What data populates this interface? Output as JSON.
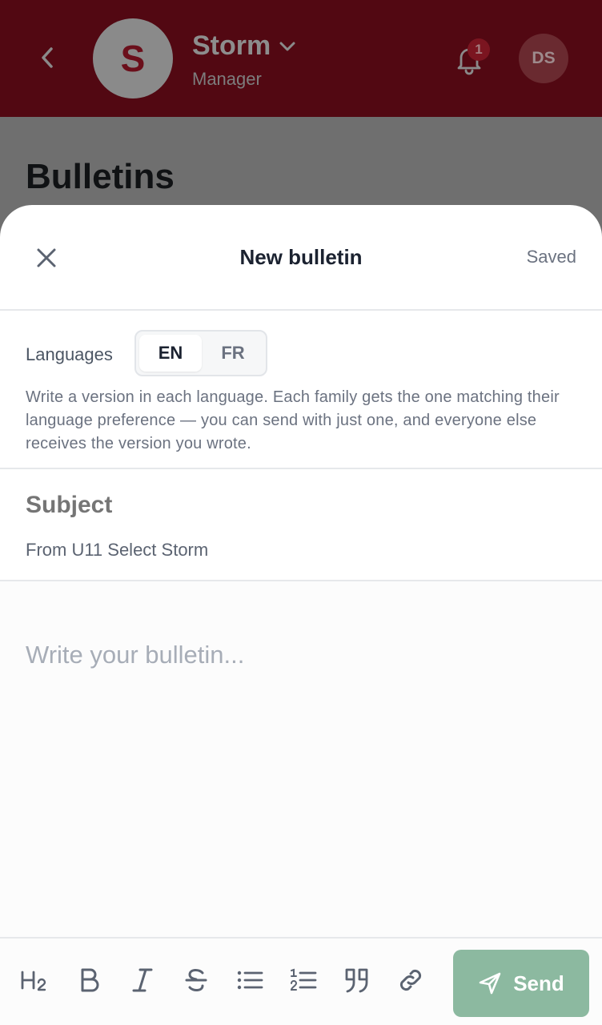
{
  "header": {
    "team_initial": "S",
    "team_name": "Storm",
    "team_role": "Manager",
    "notification_count": "1",
    "user_initials": "DS",
    "icons": [
      "back-icon",
      "chevron-down-icon",
      "bell-icon"
    ]
  },
  "page": {
    "title": "Bulletins"
  },
  "modal": {
    "title": "New bulletin",
    "status": "Saved",
    "languages": {
      "label": "Languages",
      "options": [
        "EN",
        "FR"
      ],
      "selected": "EN",
      "help": "Write a version in each language. Each family gets the one matching their language preference — you can send with just one, and everyone else receives the version you wrote."
    },
    "subject": {
      "placeholder": "Subject",
      "value": "",
      "from": "From U11 Select Storm"
    },
    "body": {
      "placeholder": "Write your bulletin..."
    },
    "toolbar": {
      "tools": [
        "heading-icon",
        "bold-icon",
        "italic-icon",
        "strikethrough-icon",
        "bullet-list-icon",
        "numbered-list-icon",
        "quote-icon",
        "link-icon"
      ],
      "send_label": "Send"
    }
  },
  "colors": {
    "header_bg": "#520812",
    "overlay": "#6f6f6f",
    "send_bg": "#8cb9a0",
    "text_dark": "#1b2230",
    "text_muted": "#6b7280"
  }
}
